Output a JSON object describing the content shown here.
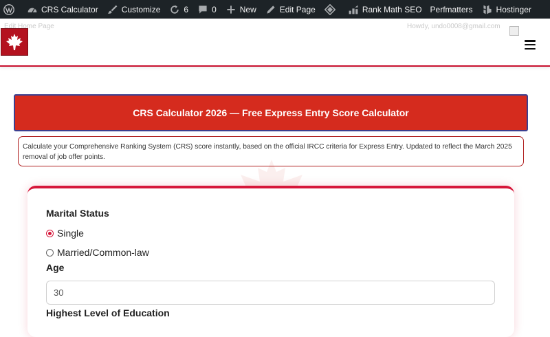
{
  "admin_bar": {
    "wp_logo_icon": "wordpress-icon",
    "site_name": "CRS Calculator",
    "customize": "Customize",
    "updates_count": "6",
    "comments_count": "0",
    "new_label": "New",
    "edit_page": "Edit Page",
    "rank_math": "Rank Math SEO",
    "perfmatters": "Perfmatters",
    "hostinger": "Hostinger"
  },
  "header": {
    "ghost_left": "Edit Home Page",
    "ghost_right": "Howdy, undo0008@gmail.com"
  },
  "page": {
    "title": "CRS Calculator 2026 — Free Express Entry Score Calculator",
    "description": "Calculate your Comprehensive Ranking System (CRS) score instantly, based on the official IRCC criteria for Express Entry. Updated to reflect the March 2025 removal of job offer points."
  },
  "form": {
    "marital_status_label": "Marital Status",
    "marital_options": [
      {
        "label": "Single",
        "checked": true
      },
      {
        "label": "Married/Common-law",
        "checked": false
      }
    ],
    "age_label": "Age",
    "age_value": "30",
    "education_label": "Highest Level of Education"
  },
  "colors": {
    "admin_bar_bg": "#1d2327",
    "brand_red": "#d52b1e",
    "accent_red": "#d6173a",
    "banner_border": "#3b3f8f"
  }
}
